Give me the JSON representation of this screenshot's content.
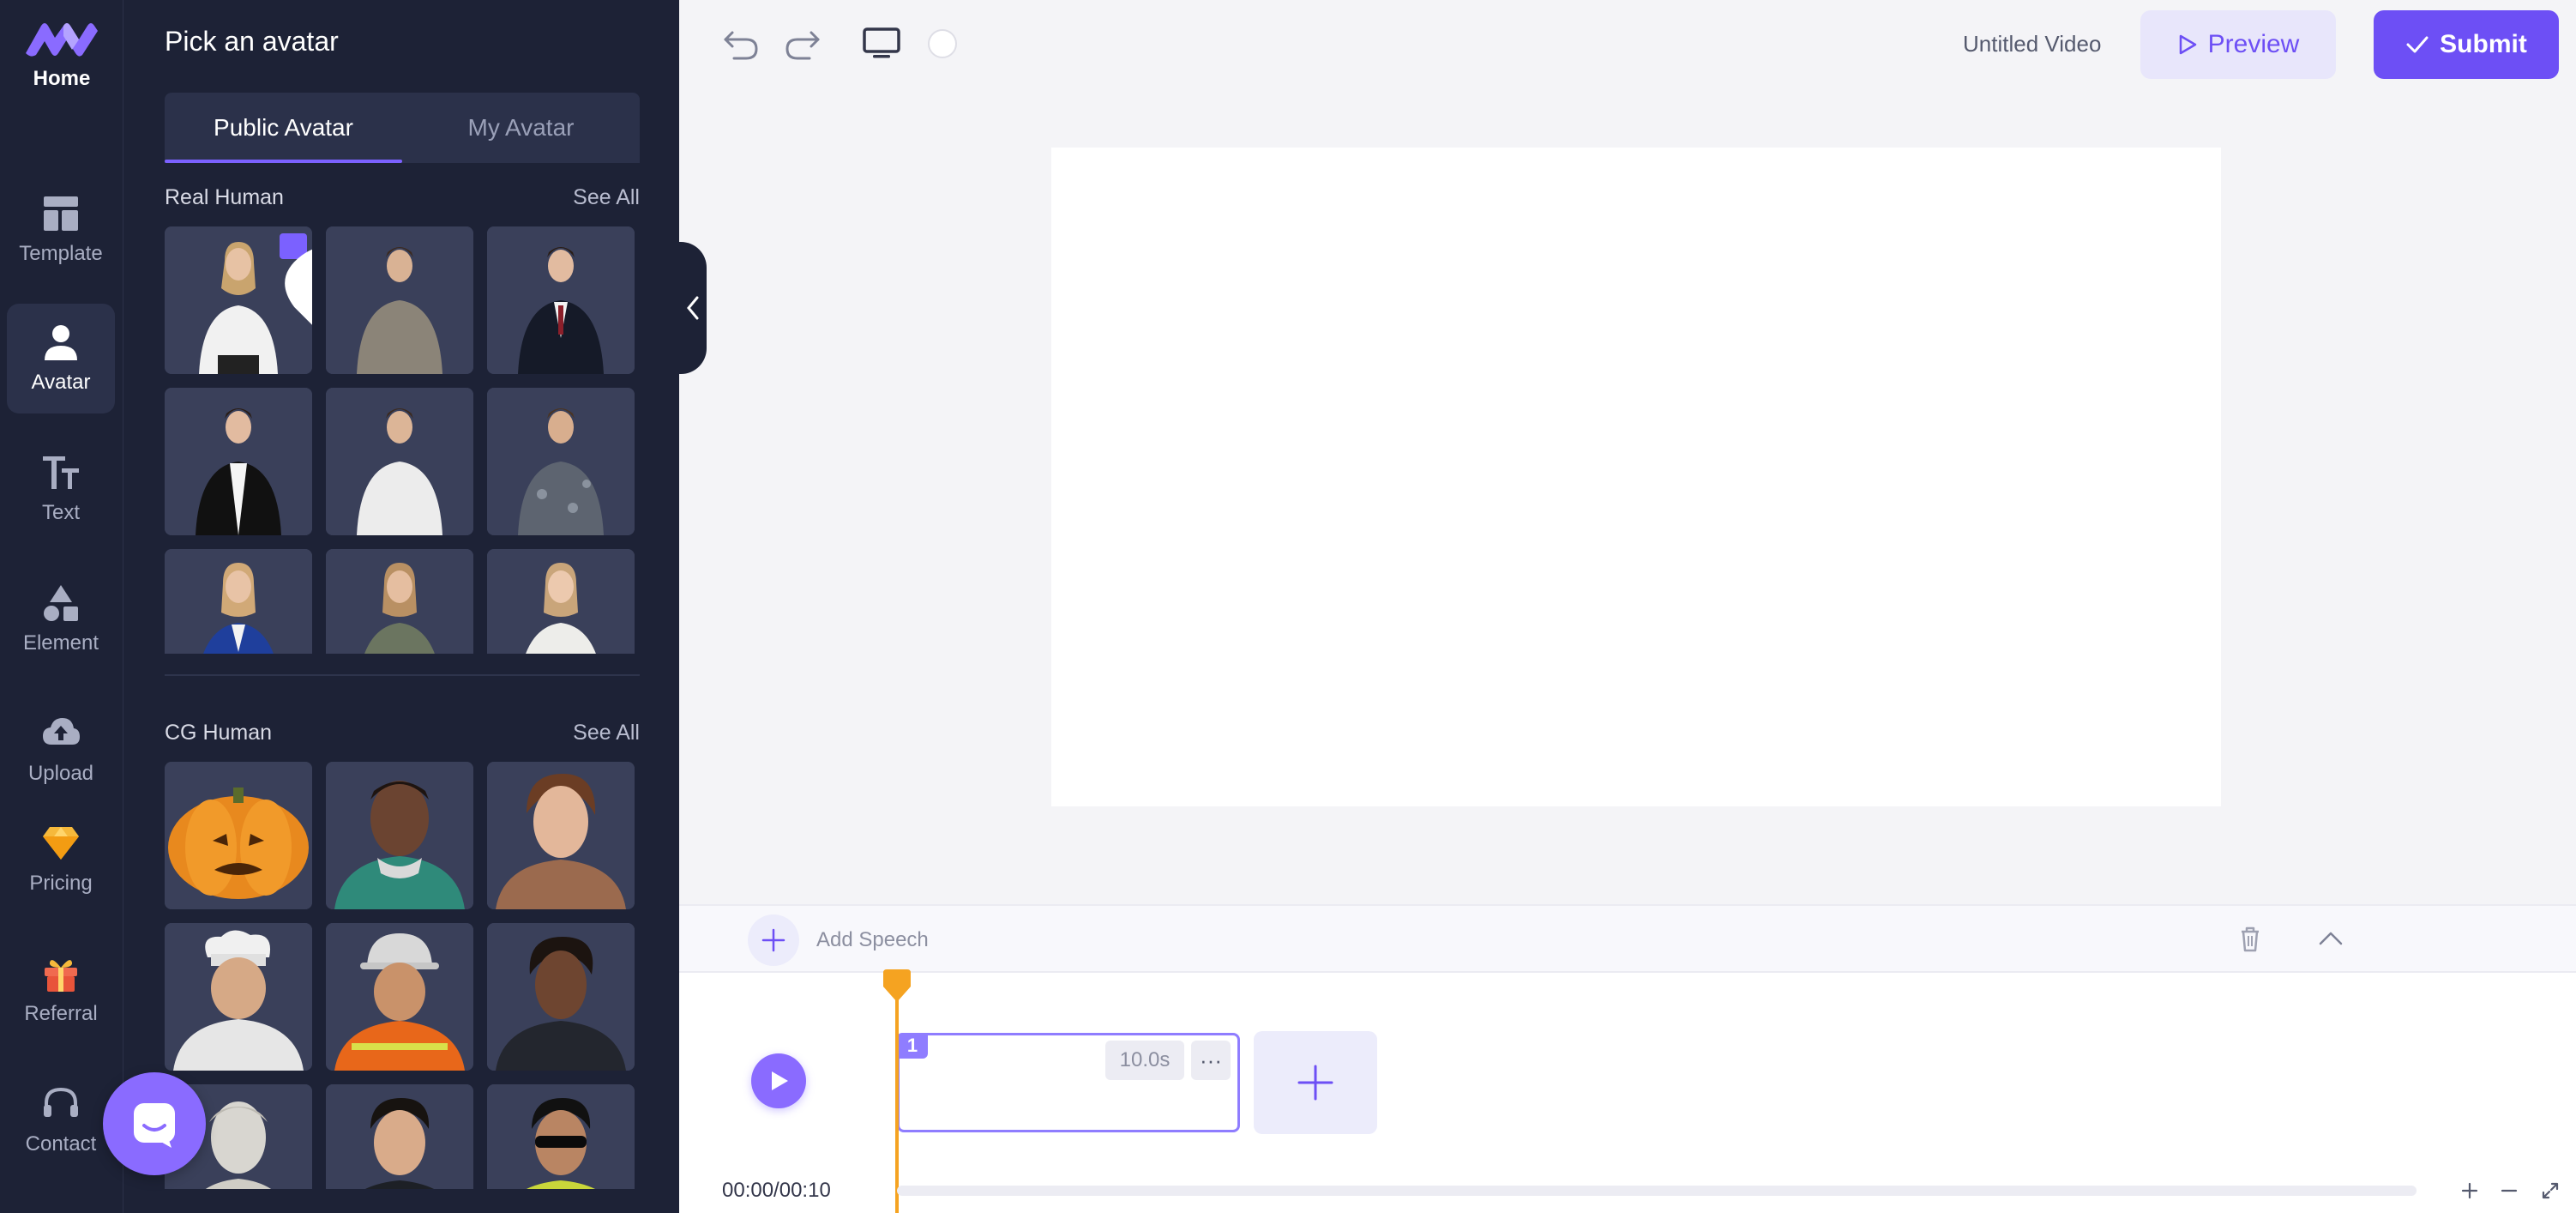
{
  "brand": {
    "home_label": "Home",
    "accent": "#6d4ff5"
  },
  "rail": {
    "items": [
      {
        "label": "Template",
        "icon": "template-icon"
      },
      {
        "label": "Avatar",
        "icon": "person-icon",
        "active": true
      },
      {
        "label": "Text",
        "icon": "text-icon"
      },
      {
        "label": "Element",
        "icon": "shapes-icon"
      },
      {
        "label": "Upload",
        "icon": "cloud-upload-icon"
      },
      {
        "label": "Pricing",
        "icon": "diamond-icon"
      },
      {
        "label": "Referral",
        "icon": "gift-icon"
      },
      {
        "label": "Contact",
        "icon": "headset-icon"
      }
    ]
  },
  "panel": {
    "title": "Pick an avatar",
    "tabs": [
      {
        "label": "Public Avatar",
        "active": true
      },
      {
        "label": "My Avatar"
      }
    ],
    "sections": [
      {
        "title": "Real Human",
        "see_all": "See All",
        "avatars": [
          "woman-white-top",
          "man-grey-shirt",
          "man-dark-suit",
          "man-black-blazer",
          "man-white-tee",
          "man-patterned-shirt",
          "woman-blue-blazer",
          "woman-green-blouse",
          "woman-white-blouse"
        ]
      },
      {
        "title": "CG Human",
        "see_all": "See All",
        "avatars": [
          "pumpkin",
          "man-green-hoodie",
          "woman-short-hair",
          "chef",
          "construction-worker",
          "woman-dark-jacket",
          "statue",
          "man-glasses",
          "man-sunglasses"
        ]
      }
    ]
  },
  "topbar": {
    "doc_title": "Untitled Video",
    "preview_label": "Preview",
    "submit_label": "Submit"
  },
  "timeline": {
    "add_speech_label": "Add Speech",
    "clip_number": "1",
    "clip_duration": "10.0s",
    "clip_more": "···",
    "time": "00:00/00:10"
  }
}
